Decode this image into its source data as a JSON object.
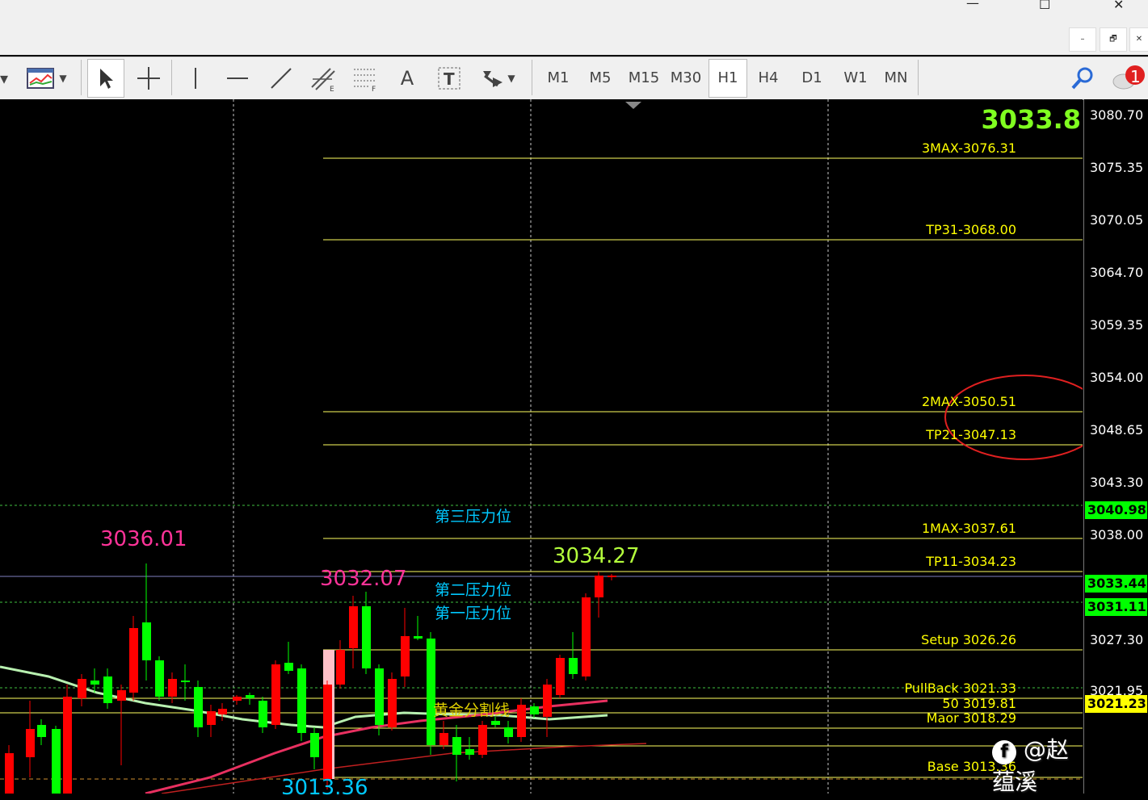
{
  "window": {
    "minimize": "—",
    "maximize": "☐",
    "close": "✕"
  },
  "mdi": {
    "minimize": "–",
    "restore": "🗗",
    "close": "✕"
  },
  "timeframes": [
    "M1",
    "M5",
    "M15",
    "M30",
    "H1",
    "H4",
    "D1",
    "W1",
    "MN"
  ],
  "active_timeframe": "H1",
  "alert_count": "1",
  "price_axis_ticks": [
    "3080.70",
    "3075.35",
    "3070.05",
    "3064.70",
    "3059.35",
    "3054.00",
    "3048.65",
    "3043.30",
    "3038.00",
    "3027.30",
    "3021.95"
  ],
  "current_price_big": "3033.8",
  "levels": {
    "max3": "3MAX-3076.31",
    "tp31": "TP31-3068.00",
    "max2": "2MAX-3050.51",
    "tp21": "TP21-3047.13",
    "max1": "1MAX-3037.61",
    "tp11": "TP11-3034.23",
    "setup": "Setup 3026.26",
    "pullback": "PullBack 3021.33",
    "fifty": "50 3019.81",
    "maor": "Maor 3018.29",
    "base": "Base 3013.36"
  },
  "axis_tags": {
    "t1": "3040.98",
    "t2": "3033.44",
    "t3": "3031.11",
    "t4": "3021.23"
  },
  "annotations": {
    "high1": "3036.01",
    "high2": "3032.07",
    "high3": "3034.27",
    "low1": "3013.36",
    "resist3": "第三压力位",
    "resist2": "第二压力位",
    "resist1": "第一压力位",
    "golden": "黄金分割线"
  },
  "watermark": "@赵蕴溪",
  "colors": {
    "bull": "#00ff00",
    "bear": "#ff0000",
    "level": "#ffff60",
    "annot_pink": "#ff3399",
    "annot_green": "#b4ff3c",
    "annot_cyan": "#00c8ff"
  }
}
